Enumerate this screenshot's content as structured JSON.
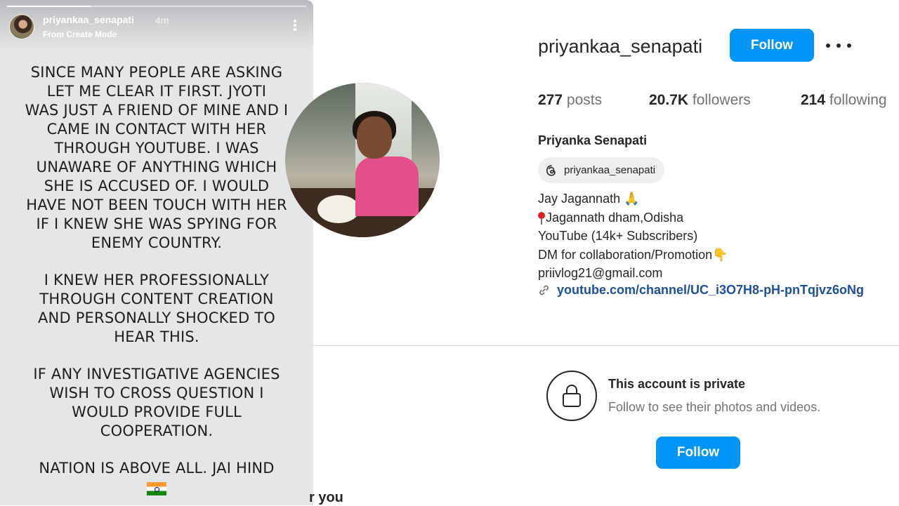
{
  "story": {
    "username": "priyankaa_senapati",
    "time": "4m",
    "subtitle": "From Create Mode",
    "paragraphs": [
      [
        "SINCE MANY PEOPLE ARE ASKING",
        "LET ME CLEAR IT FIRST. JYOTI",
        "WAS JUST A FRIEND OF MINE AND I",
        "CAME IN CONTACT WITH HER",
        "THROUGH YOUTUBE. I WAS",
        "UNAWARE OF ANYTHING WHICH",
        "SHE IS ACCUSED OF. I WOULD",
        "HAVE NOT BEEN TOUCH WITH HER",
        "IF I KNEW SHE WAS SPYING FOR",
        "ENEMY COUNTRY."
      ],
      [
        "I KNEW HER PROFESSIONALLY",
        "THROUGH CONTENT CREATION",
        "AND PERSONALLY SHOCKED TO",
        "HEAR THIS."
      ],
      [
        "IF ANY INVESTIGATIVE AGENCIES",
        "WISH TO CROSS QUESTION I",
        "WOULD PROVIDE FULL",
        "COOPERATION."
      ],
      [
        "NATION IS ABOVE ALL. JAI HIND"
      ]
    ],
    "progress_fraction": 0.28
  },
  "profile": {
    "username": "priyankaa_senapati",
    "follow_label": "Follow",
    "more_icon": "more-options-icon",
    "stats": {
      "posts_count": "277",
      "posts_label": "posts",
      "followers_count": "20.7K",
      "followers_label": "followers",
      "following_count": "214",
      "following_label": "following"
    },
    "full_name": "Priyanka Senapati",
    "threads_handle": "priyankaa_senapati",
    "bio": {
      "line1": "Jay Jagannath 🙏",
      "line2": "Jagannath dham,Odisha",
      "line3": "YouTube (14k+ Subscribers)",
      "line4": "DM for collaboration/Promotion👇",
      "line5": "priivlog21@gmail.com"
    },
    "link": "youtube.com/channel/UC_i3O7H8-pH-pnTqjvz6oNg",
    "private_title": "This account is private",
    "private_subtitle": "Follow to see their photos and videos.",
    "follow_bottom_label": "Follow",
    "suggested_partial": "r you"
  },
  "colors": {
    "accent": "#0095f6",
    "link": "#1e4f9a",
    "story_bg": "#e5e6e8"
  }
}
